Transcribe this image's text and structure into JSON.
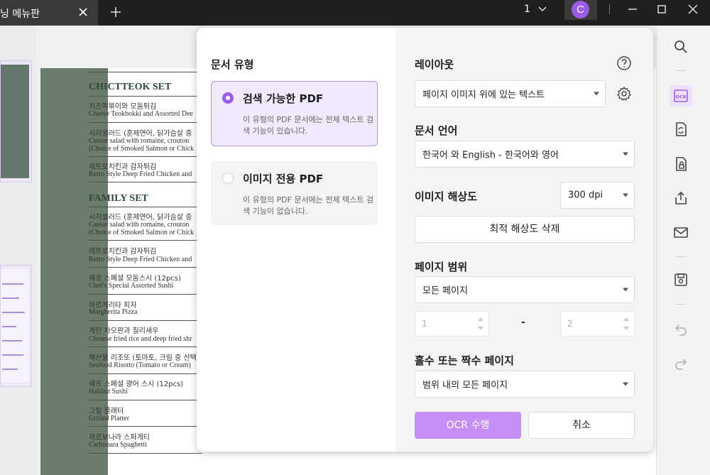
{
  "titlebar": {
    "tab_label": "닝 메뉴판",
    "page_count": "1",
    "avatar_letter": "C"
  },
  "document": {
    "sections": [
      {
        "title": "CHICTTEOK SET",
        "items": [
          {
            "ko": "치즈떡볶이와 모둠튀김",
            "en": "Cheese Teokbokki and Assorted Dee"
          },
          {
            "ko": "시저샐러드 (훈제연어, 닭가슴살 중",
            "en": "Caesar salad with romaine, crouton",
            "en2": "(Choice of Smoked Salmon or Chick"
          },
          {
            "ko": "레트로치킨과 감자튀김",
            "en": "Retro Style Deep Fried Chicken and"
          }
        ]
      },
      {
        "title": "FAMILY SET",
        "items": [
          {
            "ko": "시저샐러드 (훈제연어, 닭가슴살 중",
            "en": "Caesar salad with romaine, crouton",
            "en2": "(Choice of Smoked Salmon or Chick"
          },
          {
            "ko": "레트로치킨과 감자튀김",
            "en": "Retro Style Deep Fried Chicken and"
          },
          {
            "ko": "쉐프 스페셜 모둠스시 (12pcs)",
            "en": "Chef's Special Assorted Sushi"
          },
          {
            "ko": "마르게리타 피자",
            "en": "Margherita Pizza"
          },
          {
            "ko": "계란 차오판과 칠리새우",
            "en": "Chinese fried rice and deep fried shr"
          },
          {
            "ko": "해산물 리조또 (토마토, 크림 중 선택",
            "en": "Seafood Risotto (Tomato or Cream)"
          },
          {
            "ko": "쉐프 스페셜 광어 스시 (12pcs)",
            "en": "Halibut Sushi"
          },
          {
            "ko": "그릴 플래터",
            "en": "Grilled Platter"
          },
          {
            "ko": "까르보나라 스파게티",
            "en": "Carbonara Spaghetti"
          }
        ]
      }
    ]
  },
  "dialog": {
    "doc_type_heading": "문서 유형",
    "option_searchable": {
      "title": "검색 가능한 PDF",
      "desc": "이 유형의 PDF 문서에는 전체 텍스트 검색 기능이 있습니다."
    },
    "option_image_only": {
      "title": "이미지 전용 PDF",
      "desc": "이 유형의 PDF 문서에는 전체 텍스트 검색 기능이 없습니다."
    },
    "layout_heading": "레이아웃",
    "layout_value": "페이지 이미지 위에 있는 텍스트",
    "language_heading": "문서 언어",
    "language_value": "한국어 와 English - 한국어와 영어",
    "resolution_heading": "이미지 해상도",
    "resolution_value": "300 dpi",
    "optimize_button": "최적 해상도 삭제",
    "page_range_heading": "페이지 범위",
    "page_range_value": "모든 페이지",
    "range_from": "1",
    "range_separator": "-",
    "range_to": "2",
    "odd_even_heading": "홀수 또는 짝수 페이지",
    "odd_even_value": "범위 내의 모든 페이지",
    "ocr_button": "OCR 수행",
    "cancel_button": "취소"
  },
  "colors": {
    "accent": "#9b5ce6",
    "primary_button": "#c48ef5",
    "selected_card_bg": "#f1e9fd",
    "menu_page_green": "#6b7c6d"
  }
}
